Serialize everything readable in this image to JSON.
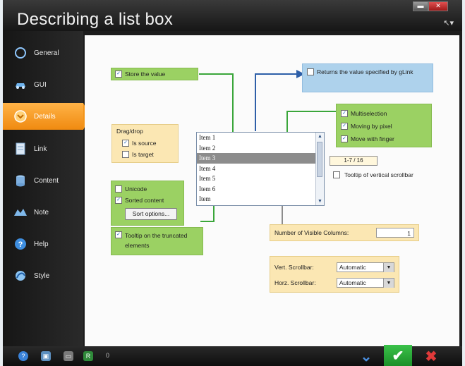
{
  "window": {
    "title": "Describing a list box",
    "minimize": "▬",
    "close": "✕",
    "cursor_icon": "pointer-cursor-icon"
  },
  "sidebar": {
    "items": [
      {
        "label": "General",
        "icon": "circle-icon"
      },
      {
        "label": "GUI",
        "icon": "car-icon"
      },
      {
        "label": "Details",
        "icon": "chevron-circle-icon",
        "active": true
      },
      {
        "label": "Link",
        "icon": "document-icon"
      },
      {
        "label": "Content",
        "icon": "database-icon"
      },
      {
        "label": "Note",
        "icon": "note-icon"
      },
      {
        "label": "Help",
        "icon": "help-icon"
      },
      {
        "label": "Style",
        "icon": "style-icon"
      }
    ]
  },
  "annotations": {
    "store_value": "Store the value",
    "returns_value": "Returns the value specified by gLink",
    "multiselection": "Multiselection",
    "moving_by_pixel": "Moving by pixel",
    "move_with_finger": "Move with finger",
    "dragdrop_title": "Drag/drop",
    "is_source": "Is source",
    "is_target": "Is target",
    "unicode": "Unicode",
    "sorted_content": "Sorted content",
    "sort_options": "Sort options...",
    "tooltip_truncated": "Tooltip on the truncated elements",
    "counter": "1-7 / 16",
    "tooltip_vscroll": "Tooltip of vertical scrollbar",
    "visible_columns_label": "Number of Visible Columns:",
    "visible_columns_value": "1",
    "vert_scrollbar_label": "Vert. Scrollbar:",
    "vert_scrollbar_value": "Automatic",
    "horz_scrollbar_label": "Horz. Scrollbar:",
    "horz_scrollbar_value": "Automatic"
  },
  "listbox": {
    "items": [
      "Item 1",
      "Item 2",
      "Item 3",
      "Item 4",
      "Item 5",
      "Item 6",
      "Item"
    ],
    "selected_index": 2
  },
  "taskbar": {
    "number": "0"
  },
  "colors": {
    "accent_orange": "#f39418",
    "green_callout": "#9bd163",
    "blue_callout": "#aed2ec",
    "tan_callout": "#fbe7b3",
    "arrow_green": "#3aa63a",
    "arrow_blue": "#2e5fa8"
  }
}
